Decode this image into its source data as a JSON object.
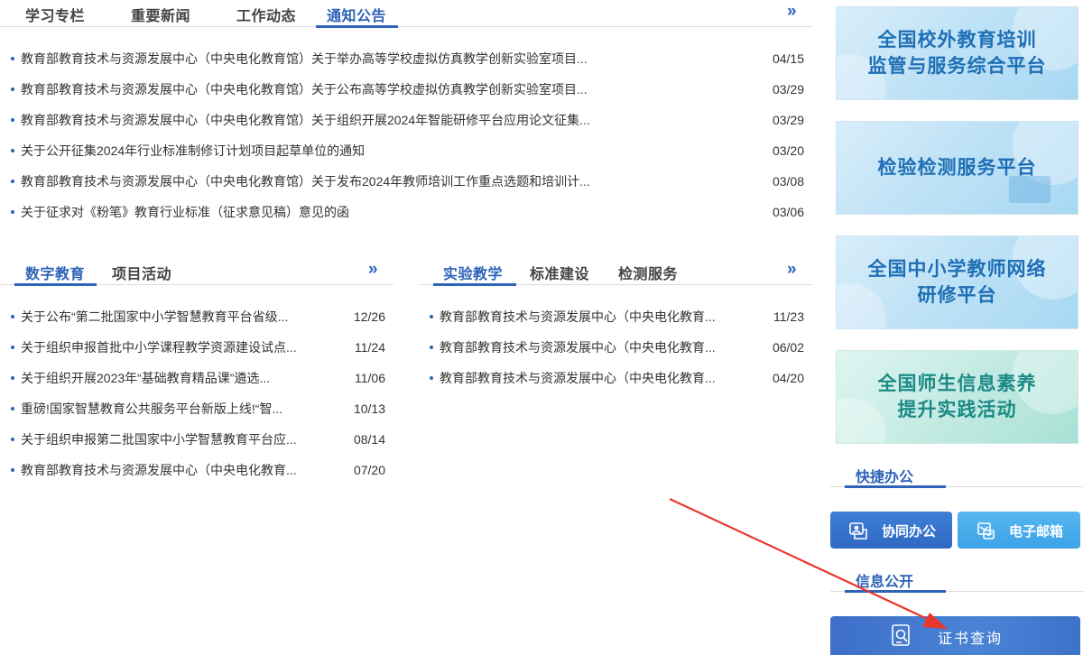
{
  "notice_panel": {
    "tabs": [
      "学习专栏",
      "重要新闻",
      "工作动态",
      "通知公告"
    ],
    "active_tab": 3,
    "more_glyph": "»",
    "items": [
      {
        "title": "教育部教育技术与资源发展中心（中央电化教育馆）关于举办高等学校虚拟仿真教学创新实验室项目...",
        "date": "04/15"
      },
      {
        "title": "教育部教育技术与资源发展中心（中央电化教育馆）关于公布高等学校虚拟仿真教学创新实验室项目...",
        "date": "03/29"
      },
      {
        "title": "教育部教育技术与资源发展中心（中央电化教育馆）关于组织开展2024年智能研修平台应用论文征集...",
        "date": "03/29"
      },
      {
        "title": "关于公开征集2024年行业标准制修订计划项目起草单位的通知",
        "date": "03/20"
      },
      {
        "title": "教育部教育技术与资源发展中心（中央电化教育馆）关于发布2024年教师培训工作重点选题和培训计...",
        "date": "03/08"
      },
      {
        "title": "关于征求对《粉笔》教育行业标准（征求意见稿）意见的函",
        "date": "03/06"
      }
    ]
  },
  "digital_panel": {
    "tabs": [
      "数字教育",
      "项目活动"
    ],
    "active_tab": 0,
    "more_glyph": "»",
    "items": [
      {
        "title": "关于公布“第二批国家中小学智慧教育平台省级...",
        "date": "12/26"
      },
      {
        "title": "关于组织申报首批中小学课程教学资源建设试点...",
        "date": "11/24"
      },
      {
        "title": "关于组织开展2023年“基础教育精品课”遴选...",
        "date": "11/06"
      },
      {
        "title": "重磅!国家智慧教育公共服务平台新版上线!“智...",
        "date": "10/13"
      },
      {
        "title": "关于组织申报第二批国家中小学智慧教育平台应...",
        "date": "08/14"
      },
      {
        "title": "教育部教育技术与资源发展中心（中央电化教育...",
        "date": "07/20"
      }
    ]
  },
  "lab_panel": {
    "tabs": [
      "实验教学",
      "标准建设",
      "检测服务"
    ],
    "active_tab": 0,
    "more_glyph": "»",
    "items": [
      {
        "title": "教育部教育技术与资源发展中心（中央电化教育...",
        "date": "11/23"
      },
      {
        "title": "教育部教育技术与资源发展中心（中央电化教育...",
        "date": "06/02"
      },
      {
        "title": "教育部教育技术与资源发展中心（中央电化教育...",
        "date": "04/20"
      }
    ]
  },
  "banners": [
    {
      "line1": "全国校外教育培训",
      "line2": "监管与服务综合平台"
    },
    {
      "line1": "检验检测服务平台",
      "line2": ""
    },
    {
      "line1": "全国中小学教师网络",
      "line2": "研修平台"
    },
    {
      "line1": "全国师生信息素养",
      "line2": "提升实践活动"
    }
  ],
  "quick_office": {
    "heading": "快捷办公",
    "collab_label": "协同办公",
    "mail_label": "电子邮箱"
  },
  "info_public": {
    "heading": "信息公开",
    "cert_label": "证书查询"
  },
  "colors": {
    "accent": "#2e63b8",
    "annotation_arrow": "#e8382b"
  }
}
